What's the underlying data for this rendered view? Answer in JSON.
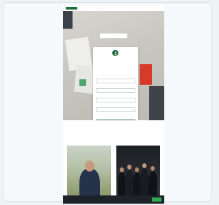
{
  "site": {
    "logo_text": "",
    "nav": [
      "",
      ""
    ]
  },
  "hero": {
    "title": "",
    "subtitle": "",
    "button_label": ""
  },
  "form": {
    "title": "",
    "description": "",
    "fields": [
      "",
      "",
      "",
      ""
    ],
    "submit_label": ""
  },
  "team_section": {
    "title": "",
    "subtitle": ""
  },
  "cookie_banner": {
    "text": "",
    "accept_label": ""
  },
  "colors": {
    "brand_green": "#1f6d3a",
    "accent_red": "#d83a2a",
    "cookie_bg": "#1e2228",
    "cookie_button": "#2faa4e"
  },
  "icons": [
    "person-icon",
    "chevron-down-icon"
  ]
}
